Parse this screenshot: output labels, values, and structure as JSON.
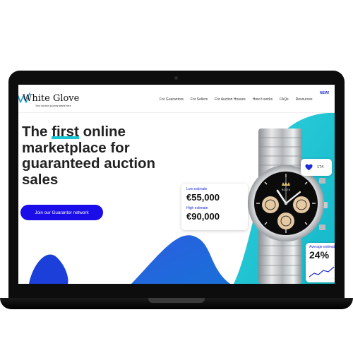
{
  "brand": {
    "name": "White Glove",
    "tagline": "Your auction journey starts here",
    "colors": {
      "primary": "#1a0de8",
      "accent_teal": "#19c6d4",
      "accent_blue": "#1d2bd6"
    }
  },
  "nav": {
    "items": [
      {
        "label": "For Guarantors"
      },
      {
        "label": "For Sellers"
      },
      {
        "label": "For Auction Houses"
      },
      {
        "label": "How it works"
      },
      {
        "label": "FAQs"
      },
      {
        "label": "Resources"
      }
    ],
    "new_badge": "NEW!"
  },
  "hero": {
    "headline_pre": "The",
    "headline_highlight": "first",
    "headline_post": " online marketplace for guaranteed auction sales",
    "cta_label": "Join our Guarantor network"
  },
  "estimate_card": {
    "low_label": "Low estimate",
    "low_value": "€55,000",
    "high_label": "High estimate",
    "high_value": "€90,000"
  },
  "likes_card": {
    "icon": "heart-icon",
    "count": "174"
  },
  "average_card": {
    "label": "Average estimate",
    "value": "24%"
  },
  "product_image": {
    "subject": "watch-image",
    "brand_text": "ROLEX"
  }
}
